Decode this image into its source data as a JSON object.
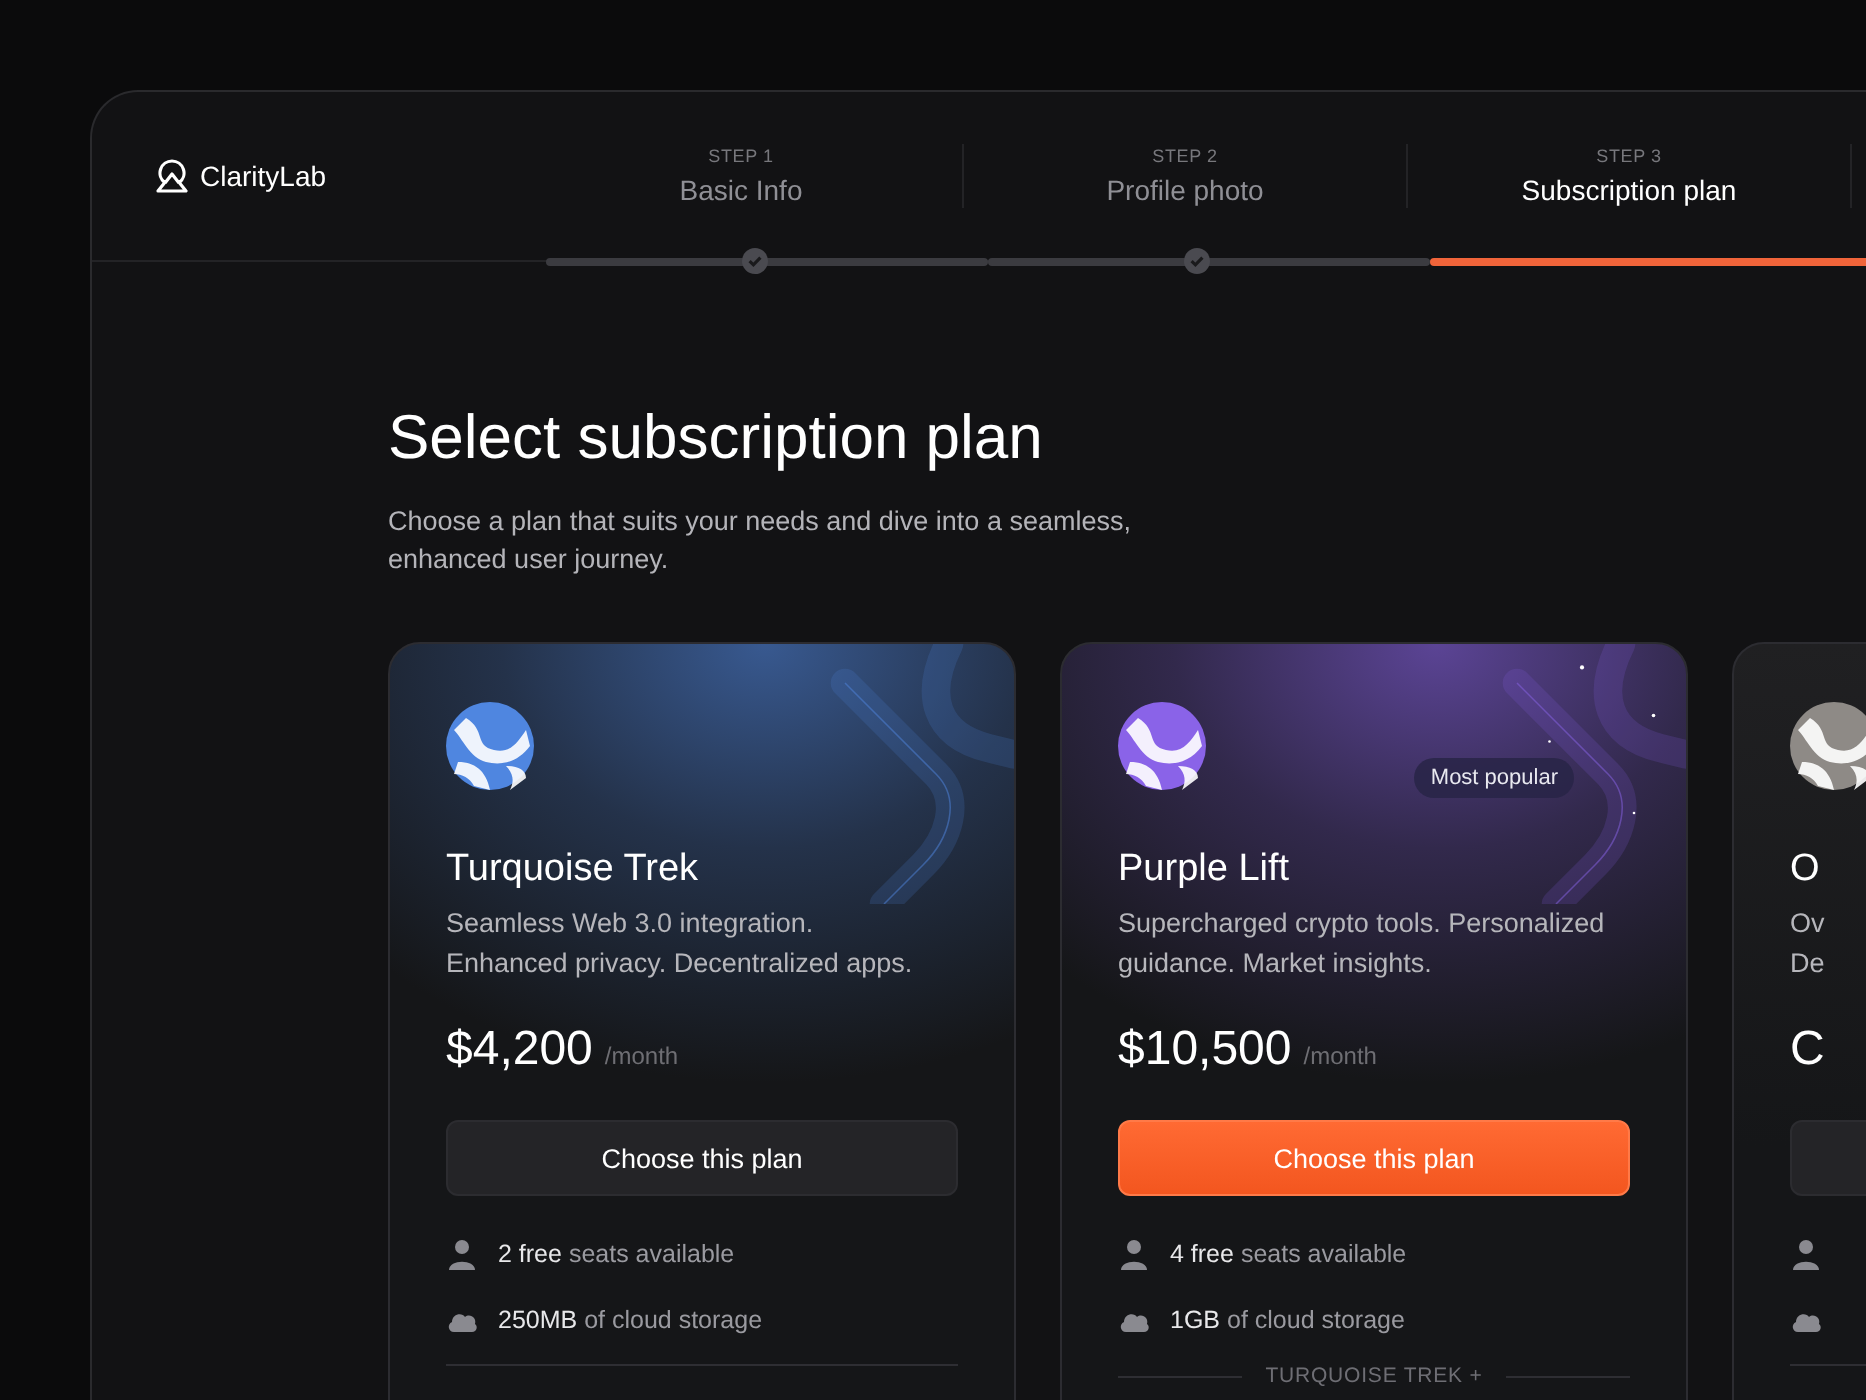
{
  "brand": {
    "name": "ClarityLab"
  },
  "steps": [
    {
      "label": "STEP 1",
      "name": "Basic Info",
      "completed": true,
      "selected": false
    },
    {
      "label": "STEP 2",
      "name": "Profile photo",
      "completed": true,
      "selected": false
    },
    {
      "label": "STEP 3",
      "name": "Subscription plan",
      "completed": false,
      "selected": true
    }
  ],
  "heading": "Select subscription plan",
  "subtitle": "Choose a plan that suits your needs and dive into a seamless, enhanced user journey.",
  "plans": [
    {
      "color": "#4f86e0",
      "name": "Turquoise Trek",
      "description": [
        "Seamless Web 3.0 integration.",
        "Enhanced privacy. Decentralized apps."
      ],
      "price": "$4,200",
      "period": "/month",
      "button": {
        "label": "Choose this plan",
        "primary": false
      },
      "features": [
        {
          "kind": "seats",
          "text": "**2 free** seats available"
        },
        {
          "kind": "storage",
          "text": "**250MB** of cloud storage"
        }
      ]
    },
    {
      "color": "#8a63e8",
      "badge": "Most popular",
      "name": "Purple Lift",
      "description": [
        "Supercharged crypto tools. Personalized",
        "guidance. Market insights."
      ],
      "price": "$10,500",
      "period": "/month",
      "button": {
        "label": "Choose this plan",
        "primary": true
      },
      "features": [
        {
          "kind": "seats",
          "text": "**4 free** seats available"
        },
        {
          "kind": "storage",
          "text": "**1GB** of cloud storage"
        }
      ],
      "includes": "TURQUOISE TREK +"
    },
    {
      "color": "#8e8a86",
      "name": "O",
      "description": [
        "Ov",
        "De"
      ],
      "price": "C",
      "button": {
        "primary": false
      },
      "features": [
        {
          "kind": "seats"
        },
        {
          "kind": "storage"
        }
      ]
    }
  ]
}
